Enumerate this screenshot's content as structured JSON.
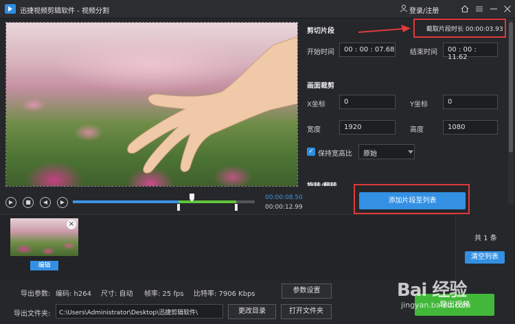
{
  "titlebar": {
    "title": "迅捷视频剪辑软件 - 视频分割",
    "login": "登录/注册",
    "icons": [
      "home-icon",
      "menu-icon",
      "minimize-icon",
      "close-icon"
    ]
  },
  "player": {
    "current_time": "00:00:08.50",
    "total_time": "00:00:12.99"
  },
  "cut": {
    "section_title": "剪切片段",
    "clip_length_label": "截取片段时长 00:00:03.93",
    "start_label": "开始时间",
    "start_value": "00 : 00 : 07.68",
    "end_label": "结束时间",
    "end_value": "00 : 00 : 11.62"
  },
  "crop": {
    "section_title": "画面裁剪",
    "x_label": "X坐标",
    "x_value": "0",
    "y_label": "Y坐标",
    "y_value": "0",
    "width_label": "宽度",
    "width_value": "1920",
    "height_label": "高度",
    "height_value": "1080",
    "keep_ratio_label": "保持宽高比",
    "keep_ratio_checked": true,
    "ratio_option": "原始"
  },
  "rotate": {
    "section_title": "旋转/翻转"
  },
  "add_button": "添加片段至列表",
  "clip_list": {
    "edit_label": "编辑",
    "count_text": "共 1 条",
    "clear_label": "清空列表"
  },
  "bottom": {
    "params_label": "导出参数:",
    "codec": "编码:  h264",
    "size": "尺寸:  自动",
    "fps": "帧率:  25 fps",
    "bitrate": "比特率:  7906 Kbps",
    "params_button": "参数设置",
    "folder_label": "导出文件夹:",
    "folder_path": "C:\\Users\\Administrator\\Desktop\\迅捷剪辑软件\\",
    "change_dir_button": "更改目录",
    "open_folder_button": "打开文件夹",
    "export_button": "导出视频"
  },
  "watermark": {
    "main": "Bai 经验",
    "sub": "jingyan.baidu.com"
  },
  "colors": {
    "accent": "#3390e3",
    "export": "#42b83a",
    "highlight_box": "#e23a3a",
    "background": "#26272b"
  }
}
